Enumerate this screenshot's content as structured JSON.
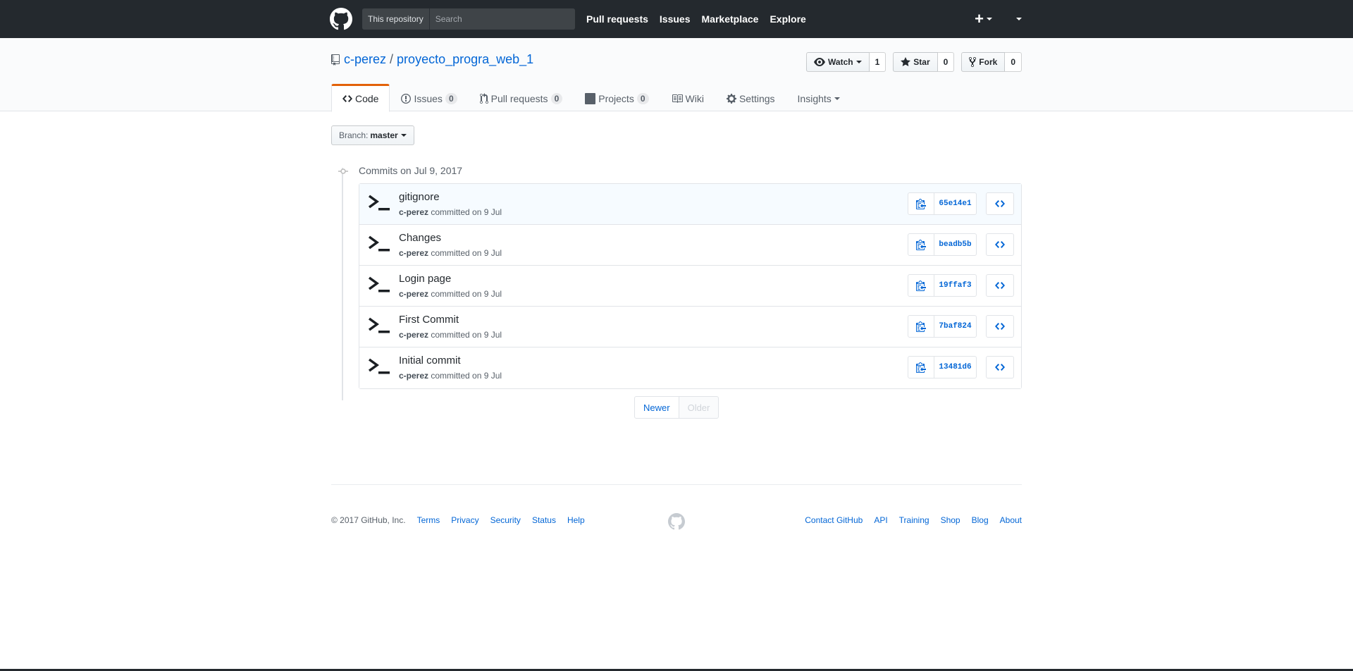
{
  "header": {
    "scope_label": "This repository",
    "search_placeholder": "Search",
    "nav": [
      "Pull requests",
      "Issues",
      "Marketplace",
      "Explore"
    ],
    "plus_label": "+"
  },
  "repo": {
    "owner": "c-perez",
    "separator": "/",
    "name": "proyecto_progra_web_1",
    "actions": {
      "watch_label": "Watch",
      "watch_count": "1",
      "star_label": "Star",
      "star_count": "0",
      "fork_label": "Fork",
      "fork_count": "0"
    },
    "tabs": {
      "code": "Code",
      "issues": "Issues",
      "issues_count": "0",
      "pulls": "Pull requests",
      "pulls_count": "0",
      "projects": "Projects",
      "projects_count": "0",
      "wiki": "Wiki",
      "settings": "Settings",
      "insights": "Insights"
    }
  },
  "branch": {
    "label": "Branch:",
    "value": "master"
  },
  "commits": {
    "group_title": "Commits on Jul 9, 2017",
    "items": [
      {
        "title": "gitignore",
        "author": "c-perez",
        "meta": " committed on 9 Jul",
        "sha": "65e14e1"
      },
      {
        "title": "Changes",
        "author": "c-perez",
        "meta": " committed on 9 Jul",
        "sha": "beadb5b"
      },
      {
        "title": "Login page",
        "author": "c-perez",
        "meta": " committed on 9 Jul",
        "sha": "19ffaf3"
      },
      {
        "title": "First Commit",
        "author": "c-perez",
        "meta": " committed on 9 Jul",
        "sha": "7baf824"
      },
      {
        "title": "Initial commit",
        "author": "c-perez",
        "meta": " committed on 9 Jul",
        "sha": "13481d6"
      }
    ]
  },
  "pagination": {
    "newer": "Newer",
    "older": "Older"
  },
  "footer": {
    "copyright": "© 2017 GitHub, Inc.",
    "left_links": [
      "Terms",
      "Privacy",
      "Security",
      "Status",
      "Help"
    ],
    "right_links": [
      "Contact GitHub",
      "API",
      "Training",
      "Shop",
      "Blog",
      "About"
    ]
  },
  "colors": {
    "header_bg": "#24292e",
    "link": "#0366d6",
    "tab_accent": "#e36209"
  }
}
